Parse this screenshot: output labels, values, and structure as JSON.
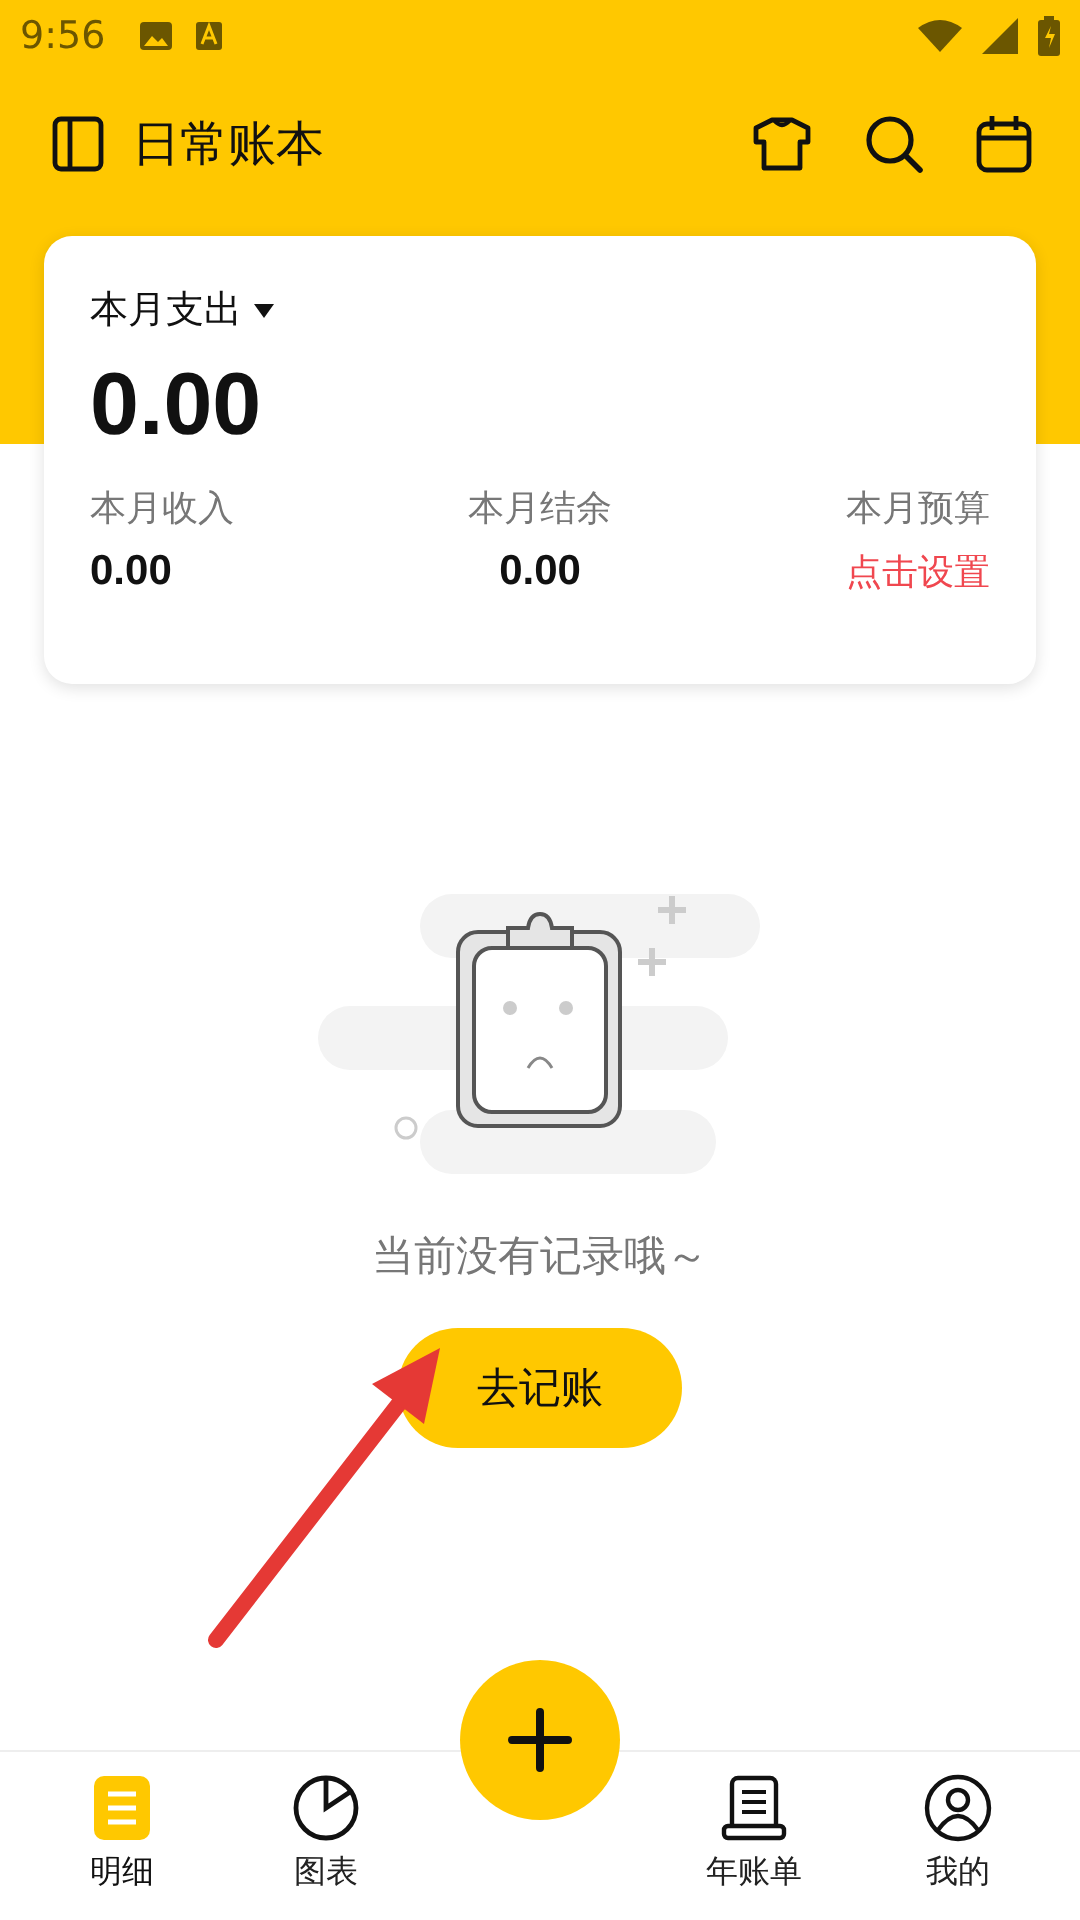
{
  "status_bar": {
    "time": "9:56"
  },
  "header": {
    "title": "日常账本"
  },
  "summary": {
    "period_label": "本月支出",
    "amount": "0.00",
    "stats": [
      {
        "label": "本月收入",
        "value": "0.00",
        "kind": "amount"
      },
      {
        "label": "本月结余",
        "value": "0.00",
        "kind": "amount"
      },
      {
        "label": "本月预算",
        "value": "点击设置",
        "kind": "link"
      }
    ]
  },
  "empty_state": {
    "message": "当前没有记录哦～",
    "button": "去记账"
  },
  "tabs": [
    {
      "label": "明细",
      "kind": "list",
      "selected": true
    },
    {
      "label": "图表",
      "kind": "pie",
      "selected": false
    },
    {
      "kind": "add",
      "selected": false
    },
    {
      "label": "年账单",
      "kind": "bill",
      "selected": false
    },
    {
      "label": "我的",
      "kind": "user",
      "selected": false
    }
  ]
}
